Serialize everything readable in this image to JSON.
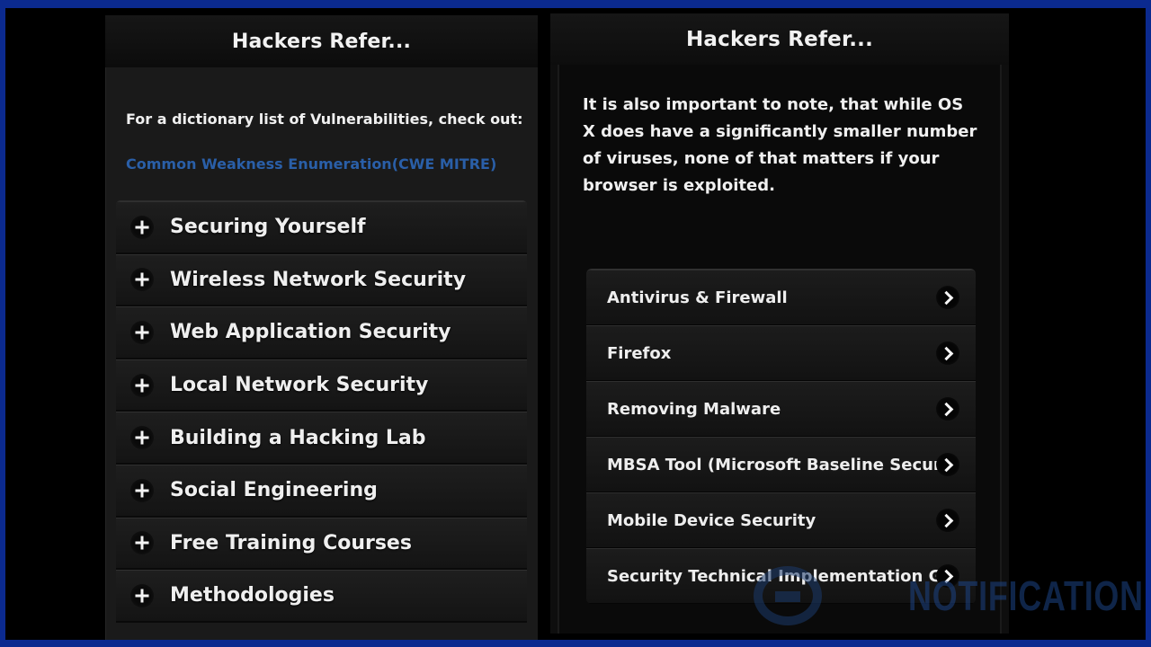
{
  "left_screen": {
    "title": "Hackers Refer...",
    "intro_text": "For a dictionary list of Vulnerabilities, check out:",
    "link_text": "Common Weakness Enumeration(CWE MITRE)",
    "accordion": [
      {
        "label": "Securing Yourself",
        "icon": "plus-icon"
      },
      {
        "label": "Wireless Network Security",
        "icon": "plus-icon"
      },
      {
        "label": "Web Application Security",
        "icon": "plus-icon"
      },
      {
        "label": "Local Network Security",
        "icon": "plus-icon"
      },
      {
        "label": "Building a Hacking Lab",
        "icon": "plus-icon"
      },
      {
        "label": "Social Engineering",
        "icon": "plus-icon"
      },
      {
        "label": "Free Training Courses",
        "icon": "plus-icon"
      },
      {
        "label": "Methodologies",
        "icon": "plus-icon"
      }
    ]
  },
  "right_screen": {
    "title": "Hackers Refer...",
    "body_text": "It is also important to note, that while OS X does have a significantly smaller number of viruses, none of that matters if your browser is exploited.",
    "nav_items": [
      {
        "label": "Antivirus & Firewall",
        "icon": "chevron-right-icon"
      },
      {
        "label": "Firefox",
        "icon": "chevron-right-icon"
      },
      {
        "label": "Removing Malware",
        "icon": "chevron-right-icon"
      },
      {
        "label": "MBSA Tool (Microsoft Baseline Securit...",
        "icon": "chevron-right-icon"
      },
      {
        "label": "Mobile Device Security",
        "icon": "chevron-right-icon"
      },
      {
        "label": "Security Technical Implementation G...",
        "icon": "chevron-right-icon"
      }
    ]
  },
  "watermark": {
    "text": "NOTIFICATION"
  },
  "colors": {
    "frame_border": "#0b2a8f",
    "link": "#2a5fa8",
    "text": "#f0f0f0",
    "background": "#141414"
  }
}
